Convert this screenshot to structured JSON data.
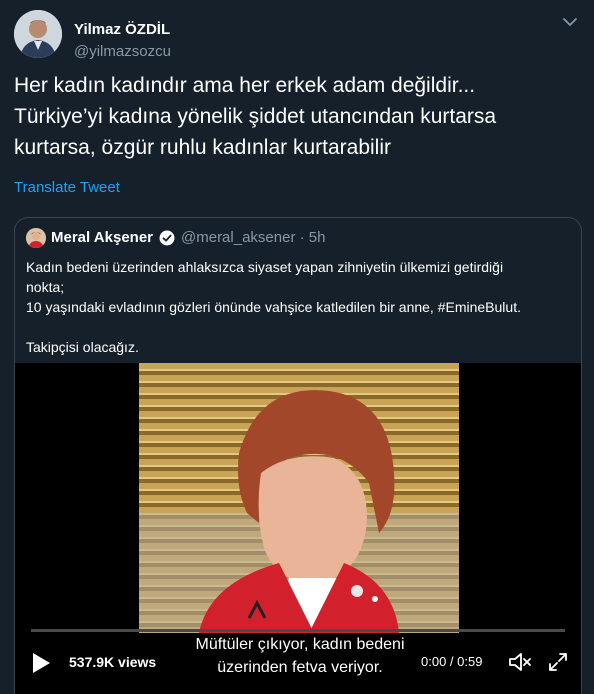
{
  "tweet": {
    "author": {
      "name": "Yilmaz ÖZDİL",
      "handle": "@yilmazsozcu"
    },
    "text_lines": [
      "Her kadın kadındır ama her erkek adam değildir...",
      "Türkiye’yi kadına yönelik şiddet utancından kurtarsa",
      "kurtarsa, özgür ruhlu kadınlar kurtarabilir"
    ],
    "translate_label": "Translate Tweet"
  },
  "quoted": {
    "name": "Meral Akşener",
    "handle": "@meral_aksener · 5h",
    "text_lines": [
      "Kadın bedeni üzerinden ahlaksızca siyaset yapan zihniyetin ülkemizi getirdiği",
      "nokta;",
      "10 yaşındaki evladının gözleri önünde vahşice katledilen bir anne, #EmineBulut.",
      "",
      "Takipçisi olacağız."
    ],
    "video": {
      "subtitle_lines": [
        "Müftüler çıkıyor, kadın bedeni",
        "üzerinden fetva veriyor."
      ],
      "views": "537.9K views",
      "time": "0:00 / 0:59",
      "progress": 0
    }
  },
  "colors": {
    "background": "#15202b",
    "link": "#1da1f2",
    "secondary_text": "#8899a6",
    "border": "#38444d"
  },
  "icons": [
    "chevron-down-icon",
    "verified-badge-icon",
    "play-icon",
    "volume-icon",
    "fullscreen-icon"
  ]
}
